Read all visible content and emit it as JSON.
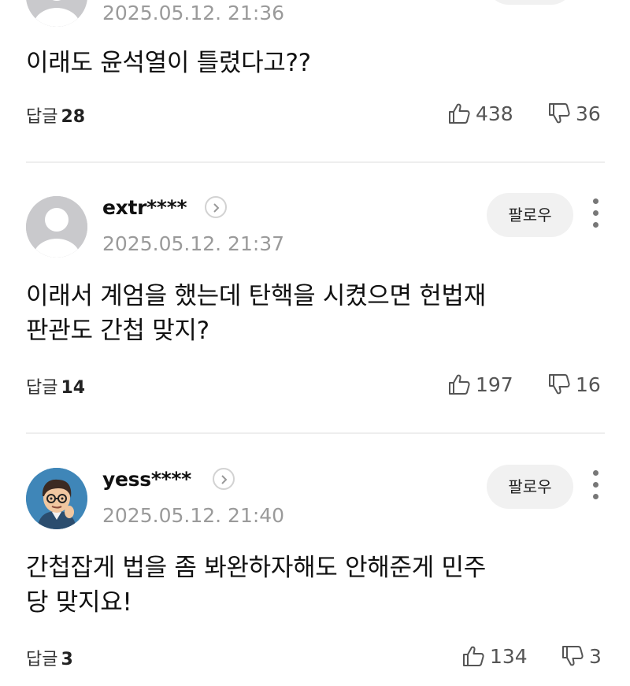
{
  "follow_label": "팔로우",
  "reply_label": "답글",
  "comments": [
    {
      "username": "",
      "timestamp": "2025.05.12. 21:36",
      "text": "이래도 윤석열이 틀렸다고??",
      "replies": "28",
      "likes": "438",
      "dislikes": "36",
      "avatar": "default-avatar"
    },
    {
      "username": "extr****",
      "timestamp": "2025.05.12. 21:37",
      "text": "이래서 계엄을 했는데 탄핵을 시켰으면 헌법재\n판관도 간첩 맞지?",
      "replies": "14",
      "likes": "197",
      "dislikes": "16",
      "avatar": "default-avatar"
    },
    {
      "username": "yess****",
      "timestamp": "2025.05.12. 21:40",
      "text": "간첩잡게 법을 좀 봐완하자해도 안해준게 민주\n당 맞지요!",
      "replies": "3",
      "likes": "134",
      "dislikes": "3",
      "avatar": "cartoon-avatar"
    }
  ],
  "colors": {
    "timestamp": "#9a9a9a",
    "follow_bg": "#f1f1f1",
    "divider": "#eeeeee",
    "vote": "#555555"
  }
}
